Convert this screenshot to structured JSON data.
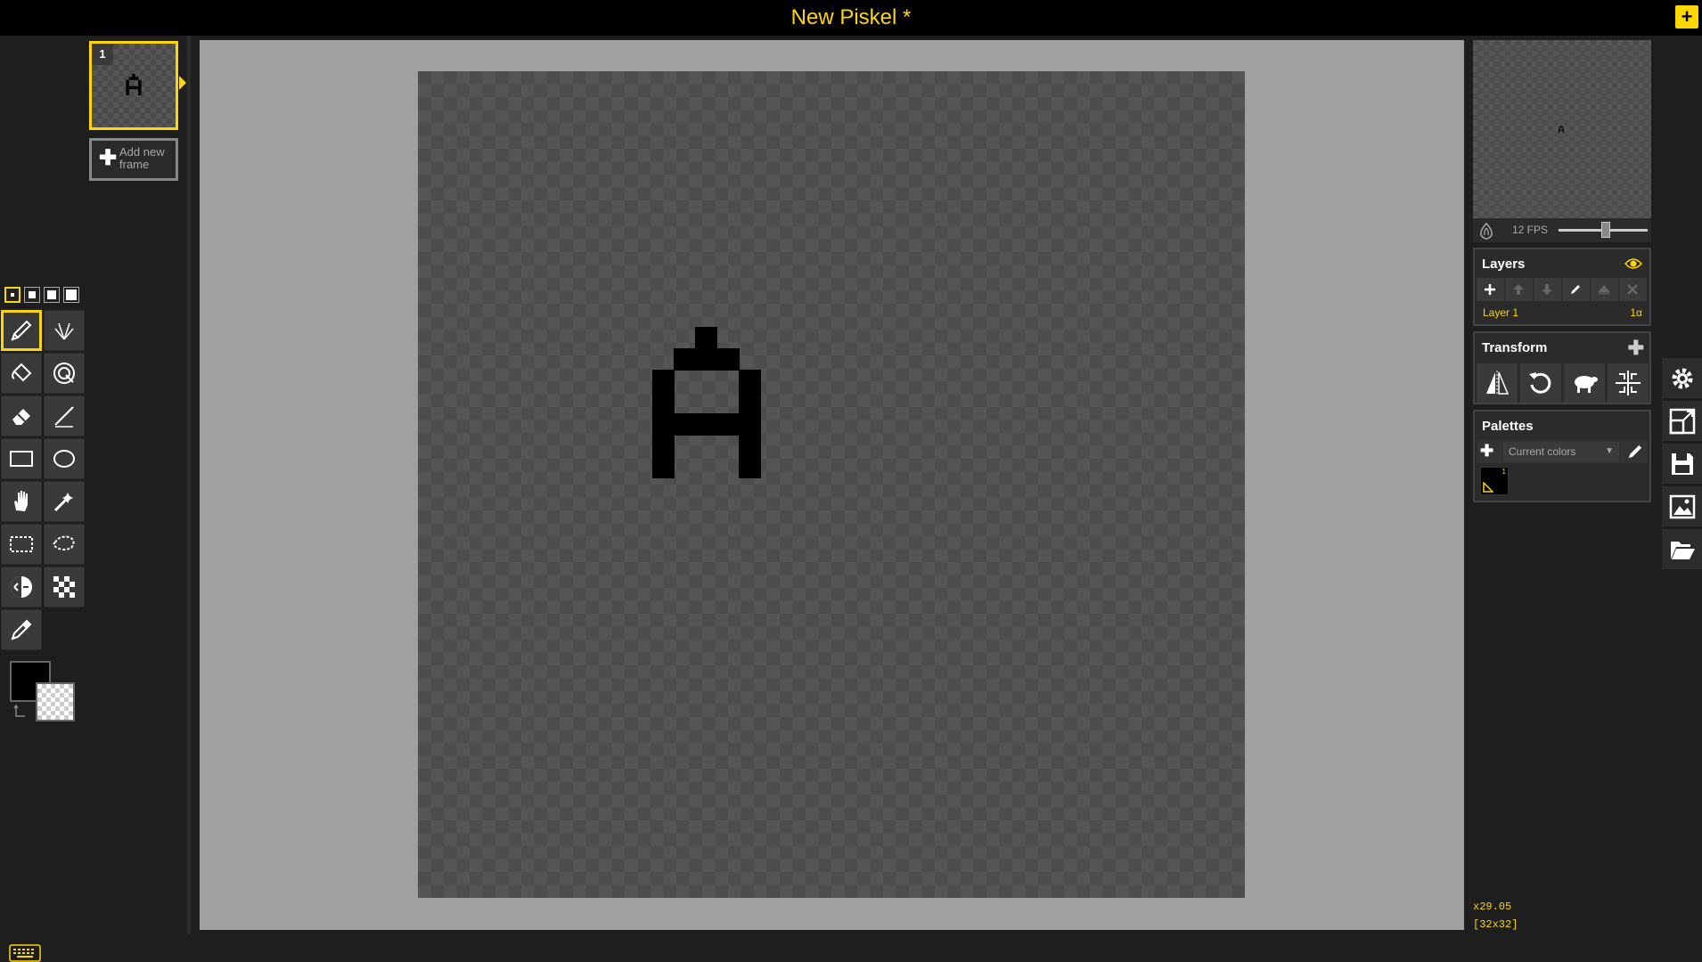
{
  "header": {
    "title": "New Piskel *",
    "add_icon": "plus-icon"
  },
  "frames": {
    "items": [
      {
        "number": "1",
        "glyph": "A"
      }
    ],
    "add_label": "Add new frame"
  },
  "tools": {
    "pen_sizes": [
      "1",
      "2",
      "3",
      "4"
    ],
    "selected_pen_size": "1",
    "items": [
      {
        "name": "pen",
        "icon": "pencil-icon",
        "selected": true
      },
      {
        "name": "vertical-mirror-pen",
        "icon": "mirror-pen-icon"
      },
      {
        "name": "paint-bucket",
        "icon": "bucket-icon"
      },
      {
        "name": "paint-all-same-color",
        "icon": "spiral-icon"
      },
      {
        "name": "eraser",
        "icon": "eraser-icon"
      },
      {
        "name": "stroke",
        "icon": "line-icon"
      },
      {
        "name": "rectangle",
        "icon": "rectangle-icon"
      },
      {
        "name": "circle",
        "icon": "ellipse-icon"
      },
      {
        "name": "move",
        "icon": "hand-icon"
      },
      {
        "name": "shape-selection",
        "icon": "magic-wand-icon"
      },
      {
        "name": "rectangle-selection",
        "icon": "rect-select-icon"
      },
      {
        "name": "lasso-selection",
        "icon": "lasso-icon"
      },
      {
        "name": "lighten",
        "icon": "lighten-icon"
      },
      {
        "name": "dithering",
        "icon": "dither-icon"
      },
      {
        "name": "color-picker",
        "icon": "eyedropper-icon"
      }
    ],
    "primary_color": "#000000",
    "secondary_color": "transparent"
  },
  "canvas": {
    "pixel_color": "#000000"
  },
  "preview": {
    "fps_label": "12 FPS",
    "fps_value": 12
  },
  "layers": {
    "title": "Layers",
    "items": [
      {
        "name": "Layer 1",
        "opacity": "1α"
      }
    ]
  },
  "transform": {
    "title": "Transform",
    "tools": [
      "flip-icon",
      "rotate-icon",
      "sheep-icon",
      "center-icon"
    ]
  },
  "palettes": {
    "title": "Palettes",
    "selected": "Current colors",
    "swatches": [
      {
        "color": "#000000",
        "index": "1"
      }
    ]
  },
  "status": {
    "zoom": "x29.05",
    "size": "[32x32]"
  },
  "colors": {
    "accent": "#ffd700",
    "background": "#1e1e1e",
    "drawing_area": "#a0a0a0"
  },
  "settings": [
    "gear-icon",
    "resize-icon",
    "save-icon",
    "export-image-icon",
    "open-folder-icon"
  ]
}
